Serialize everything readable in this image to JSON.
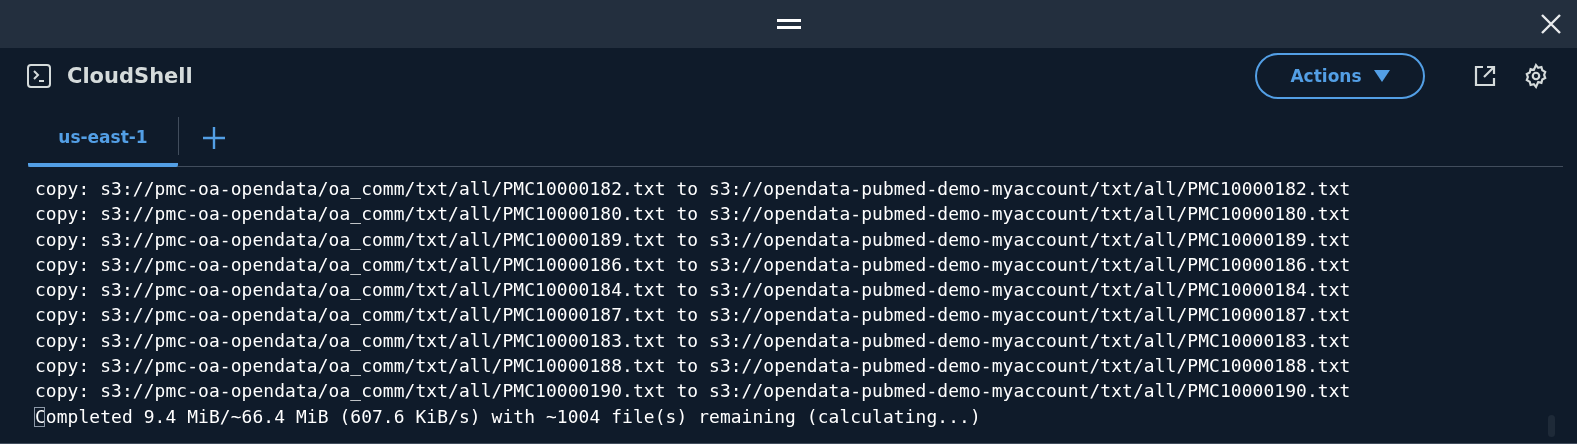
{
  "header": {
    "title": "CloudShell",
    "actions_button": "Actions"
  },
  "tabs": [
    {
      "label": "us-east-1",
      "selected": true
    }
  ],
  "terminal": {
    "lines": [
      "copy: s3://pmc-oa-opendata/oa_comm/txt/all/PMC10000182.txt to s3://opendata-pubmed-demo-myaccount/txt/all/PMC10000182.txt",
      "copy: s3://pmc-oa-opendata/oa_comm/txt/all/PMC10000180.txt to s3://opendata-pubmed-demo-myaccount/txt/all/PMC10000180.txt",
      "copy: s3://pmc-oa-opendata/oa_comm/txt/all/PMC10000189.txt to s3://opendata-pubmed-demo-myaccount/txt/all/PMC10000189.txt",
      "copy: s3://pmc-oa-opendata/oa_comm/txt/all/PMC10000186.txt to s3://opendata-pubmed-demo-myaccount/txt/all/PMC10000186.txt",
      "copy: s3://pmc-oa-opendata/oa_comm/txt/all/PMC10000184.txt to s3://opendata-pubmed-demo-myaccount/txt/all/PMC10000184.txt",
      "copy: s3://pmc-oa-opendata/oa_comm/txt/all/PMC10000187.txt to s3://opendata-pubmed-demo-myaccount/txt/all/PMC10000187.txt",
      "copy: s3://pmc-oa-opendata/oa_comm/txt/all/PMC10000183.txt to s3://opendata-pubmed-demo-myaccount/txt/all/PMC10000183.txt",
      "copy: s3://pmc-oa-opendata/oa_comm/txt/all/PMC10000188.txt to s3://opendata-pubmed-demo-myaccount/txt/all/PMC10000188.txt",
      "copy: s3://pmc-oa-opendata/oa_comm/txt/all/PMC10000190.txt to s3://opendata-pubmed-demo-myaccount/txt/all/PMC10000190.txt",
      "Completed 9.4 MiB/~66.4 MiB (607.6 KiB/s) with ~1004 file(s) remaining (calculating...)"
    ]
  }
}
